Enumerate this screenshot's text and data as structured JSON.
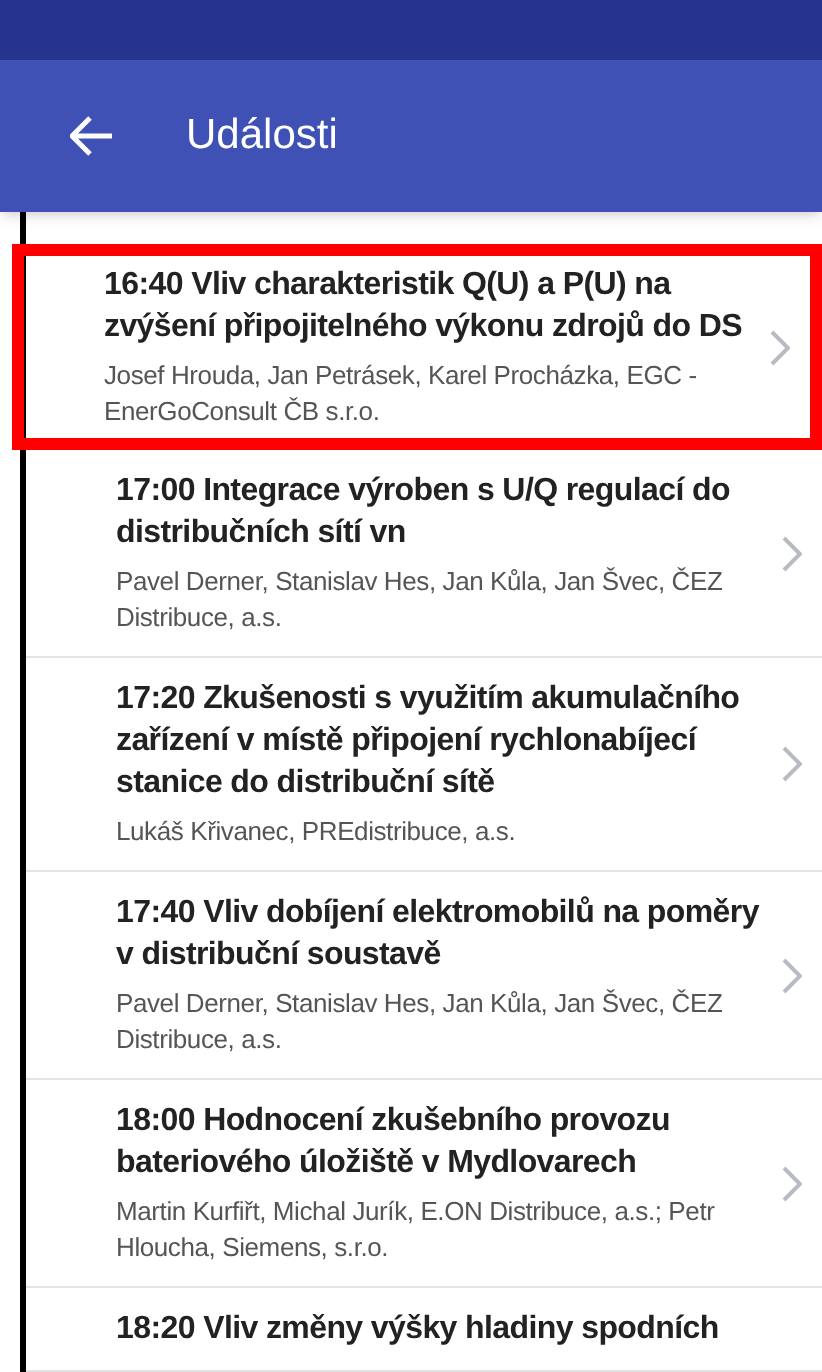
{
  "app_bar": {
    "title": "Události"
  },
  "events": [
    {
      "title": "16:40 Vliv charakteristik Q(U) a P(U) na zvýšení připojitelného výkonu zdrojů do DS",
      "authors": "Josef Hrouda, Jan Petrásek, Karel Procházka, EGC - EnerGoConsult ČB s.r.o.",
      "highlighted": true
    },
    {
      "title": "17:00 Integrace výroben s U/Q regulací do distribučních sítí vn",
      "authors": "Pavel Derner, Stanislav Hes, Jan Kůla, Jan Švec, ČEZ Distribuce, a.s.",
      "highlighted": false
    },
    {
      "title": "17:20 Zkušenosti s využitím akumulačního zařízení v místě připojení rychlonabíjecí stanice do distribuční sítě",
      "authors": "Lukáš Křivanec, PREdistribuce, a.s.",
      "highlighted": false
    },
    {
      "title": "17:40 Vliv dobíjení elektromobilů na poměry v distribuční soustavě",
      "authors": "Pavel Derner, Stanislav Hes, Jan Kůla, Jan Švec, ČEZ Distribuce, a.s.",
      "highlighted": false
    },
    {
      "title": "18:00 Hodnocení zkušebního provozu bateriového úložiště v Mydlovarech",
      "authors": "Martin Kurfiřt, Michal Jurík, E.ON Distribuce, a.s.; Petr Hloucha, Siemens, s.r.o.",
      "highlighted": false
    },
    {
      "title": "18:20 Vliv změny výšky hladiny spodních",
      "highlighted": false
    }
  ]
}
